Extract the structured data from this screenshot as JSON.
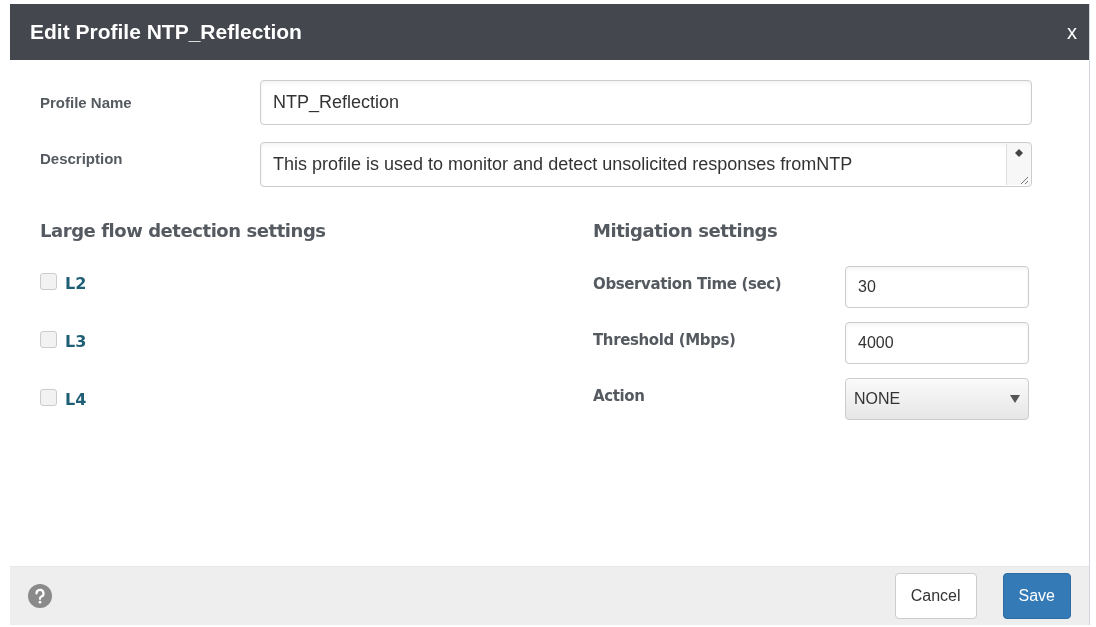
{
  "dialog": {
    "title": "Edit Profile NTP_Reflection",
    "close": "x"
  },
  "fields": [
    {
      "label": "Profile Name",
      "value": "NTP_Reflection",
      "kind": "input"
    },
    {
      "label": "Description",
      "value": "This profile is used to monitor and detect unsolicited responses fromNTP",
      "kind": "textarea"
    }
  ],
  "detection": {
    "heading": "Large flow detection settings",
    "options": [
      {
        "label": "L2",
        "checked": false
      },
      {
        "label": "L3",
        "checked": false
      },
      {
        "label": "L4",
        "checked": false
      }
    ]
  },
  "mitigation": {
    "heading": "Mitigation settings",
    "fields": [
      {
        "label": "Observation Time (sec)",
        "value": "30",
        "kind": "input"
      },
      {
        "label": "Threshold (Mbps)",
        "value": "4000",
        "kind": "input"
      },
      {
        "label": "Action",
        "value": "NONE",
        "kind": "select"
      }
    ]
  },
  "footer": {
    "buttons": [
      {
        "label": "Cancel",
        "kind": "secondary"
      },
      {
        "label": "Save",
        "kind": "primary"
      }
    ]
  }
}
